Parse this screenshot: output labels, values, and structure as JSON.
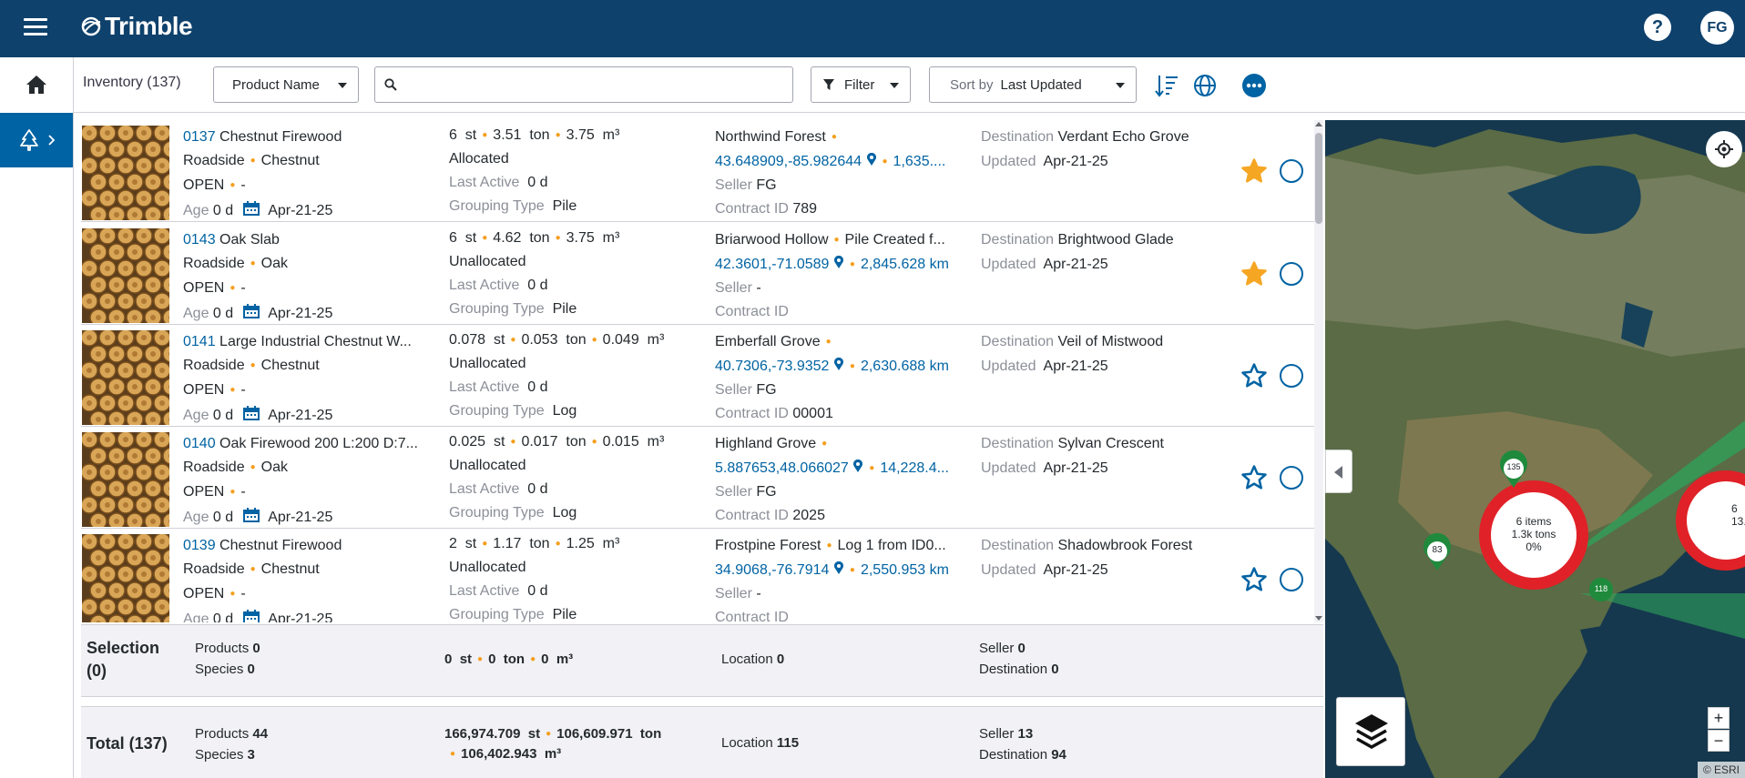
{
  "header": {
    "brand": "Trimble",
    "help_label": "?",
    "avatar_initials": "FG"
  },
  "toolbar": {
    "inventory_title": "Inventory (137)",
    "field_select": "Product Name",
    "search_value": "",
    "filter_label": "Filter",
    "sort_prefix": "Sort by",
    "sort_value": "Last Updated"
  },
  "rows": [
    {
      "id": "0137",
      "name": "Chestnut Firewood",
      "location_type": "Roadside",
      "species": "Chestnut",
      "status": "OPEN",
      "status_extra": "-",
      "age_label": "Age",
      "age": "0 d",
      "date": "Apr-21-25",
      "q_st": "6",
      "q_ton": "3.51",
      "q_m3": "3.75",
      "allocation": "Allocated",
      "last_active_label": "Last Active",
      "last_active": "0 d",
      "grouping_label": "Grouping Type",
      "grouping": "Pile",
      "forest": "Northwind Forest",
      "forest_extra": "",
      "coords": "43.648909,-85.982644",
      "distance": "1,635....",
      "seller_label": "Seller",
      "seller": "FG",
      "contract_label": "Contract ID",
      "contract": "789",
      "destination_label": "Destination",
      "destination": "Verdant Echo Grove",
      "updated_label": "Updated",
      "updated": "Apr-21-25",
      "starred": true
    },
    {
      "id": "0143",
      "name": "Oak Slab",
      "location_type": "Roadside",
      "species": "Oak",
      "status": "OPEN",
      "status_extra": "-",
      "age_label": "Age",
      "age": "0 d",
      "date": "Apr-21-25",
      "q_st": "6",
      "q_ton": "4.62",
      "q_m3": "3.75",
      "allocation": "Unallocated",
      "last_active_label": "Last Active",
      "last_active": "0 d",
      "grouping_label": "Grouping Type",
      "grouping": "Pile",
      "forest": "Briarwood Hollow",
      "forest_extra": "Pile Created f...",
      "coords": "42.3601,-71.0589",
      "distance": "2,845.628 km",
      "seller_label": "Seller",
      "seller": "-",
      "contract_label": "Contract ID",
      "contract": "",
      "destination_label": "Destination",
      "destination": "Brightwood Glade",
      "updated_label": "Updated",
      "updated": "Apr-21-25",
      "starred": true
    },
    {
      "id": "0141",
      "name": "Large Industrial Chestnut W...",
      "location_type": "Roadside",
      "species": "Chestnut",
      "status": "OPEN",
      "status_extra": "-",
      "age_label": "Age",
      "age": "0 d",
      "date": "Apr-21-25",
      "q_st": "0.078",
      "q_ton": "0.053",
      "q_m3": "0.049",
      "allocation": "Unallocated",
      "last_active_label": "Last Active",
      "last_active": "0 d",
      "grouping_label": "Grouping Type",
      "grouping": "Log",
      "forest": "Emberfall Grove",
      "forest_extra": "",
      "coords": "40.7306,-73.9352",
      "distance": "2,630.688 km",
      "seller_label": "Seller",
      "seller": "FG",
      "contract_label": "Contract ID",
      "contract": "00001",
      "destination_label": "Destination",
      "destination": "Veil of Mistwood",
      "updated_label": "Updated",
      "updated": "Apr-21-25",
      "starred": false
    },
    {
      "id": "0140",
      "name": "Oak Firewood 200 L:200 D:7...",
      "location_type": "Roadside",
      "species": "Oak",
      "status": "OPEN",
      "status_extra": "-",
      "age_label": "Age",
      "age": "0 d",
      "date": "Apr-21-25",
      "q_st": "0.025",
      "q_ton": "0.017",
      "q_m3": "0.015",
      "allocation": "Unallocated",
      "last_active_label": "Last Active",
      "last_active": "0 d",
      "grouping_label": "Grouping Type",
      "grouping": "Log",
      "forest": "Highland Grove",
      "forest_extra": "",
      "coords": "5.887653,48.066027",
      "distance": "14,228.4...",
      "seller_label": "Seller",
      "seller": "FG",
      "contract_label": "Contract ID",
      "contract": "2025",
      "destination_label": "Destination",
      "destination": "Sylvan Crescent",
      "updated_label": "Updated",
      "updated": "Apr-21-25",
      "starred": false
    },
    {
      "id": "0139",
      "name": "Chestnut Firewood",
      "location_type": "Roadside",
      "species": "Chestnut",
      "status": "OPEN",
      "status_extra": "-",
      "age_label": "Age",
      "age": "0 d",
      "date": "Apr-21-25",
      "q_st": "2",
      "q_ton": "1.17",
      "q_m3": "1.25",
      "allocation": "Unallocated",
      "last_active_label": "Last Active",
      "last_active": "0 d",
      "grouping_label": "Grouping Type",
      "grouping": "Pile",
      "forest": "Frostpine Forest",
      "forest_extra": "Log 1 from ID0...",
      "coords": "34.9068,-76.7914",
      "distance": "2,550.953 km",
      "seller_label": "Seller",
      "seller": "-",
      "contract_label": "Contract ID",
      "contract": "",
      "destination_label": "Destination",
      "destination": "Shadowbrook Forest",
      "updated_label": "Updated",
      "updated": "Apr-21-25",
      "starred": false
    }
  ],
  "units": {
    "st": "st",
    "ton": "ton",
    "m3": "m³"
  },
  "selection": {
    "title": "Selection",
    "count": "(0)",
    "products_label": "Products",
    "products": "0",
    "species_label": "Species",
    "species": "0",
    "st": "0",
    "ton": "0",
    "m3": "0",
    "location_label": "Location",
    "location": "0",
    "seller_label": "Seller",
    "seller": "0",
    "destination_label": "Destination",
    "destination": "0"
  },
  "total": {
    "title": "Total (137)",
    "products_label": "Products",
    "products": "44",
    "species_label": "Species",
    "species": "3",
    "st": "166,974.709",
    "ton": "106,609.971",
    "m3": "106,402.943",
    "location_label": "Location",
    "location": "115",
    "seller_label": "Seller",
    "seller": "13",
    "destination_label": "Destination",
    "destination": "94"
  },
  "map": {
    "cluster_line1": "6 items",
    "cluster_line2": "1.3k tons",
    "cluster_line3": "0%",
    "partial_cluster_1": "6",
    "partial_cluster_2": "13.",
    "marker_1": "83",
    "marker_2": "135",
    "marker_3": "118",
    "zoom_in": "+",
    "zoom_out": "−",
    "attribution": "© ESRI",
    "colors": {
      "cluster_ring": "#e02127",
      "marker": "#1f8a3c",
      "ocean": "#15384e"
    }
  }
}
